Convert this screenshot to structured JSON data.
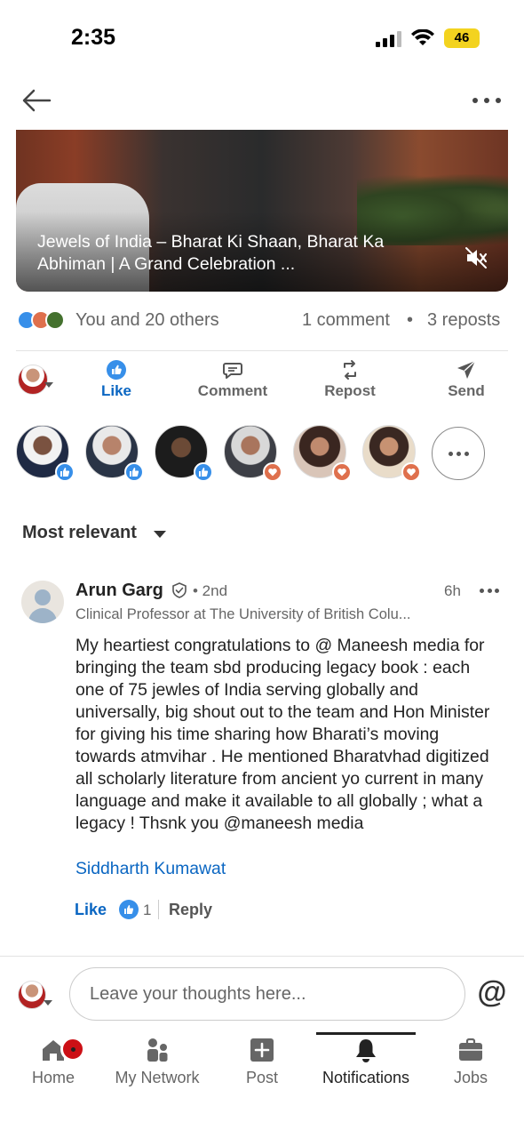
{
  "status_bar": {
    "time": "2:35",
    "battery": "46"
  },
  "header": {
    "back_icon": "arrow-left-icon",
    "more_icon": "ellipsis-icon"
  },
  "video": {
    "caption": "Jewels of India –  Bharat Ki Shaan, Bharat Ka Abhiman | A Grand Celebration ...",
    "mute_icon": "speaker-muted-icon"
  },
  "social_counts": {
    "reactions_text": "You and 20 others",
    "comments_text": "1 comment",
    "separator": "•",
    "reposts_text": "3 reposts"
  },
  "actions": {
    "like": "Like",
    "comment": "Comment",
    "repost": "Repost",
    "send": "Send"
  },
  "reactors": [
    {
      "reaction": "like"
    },
    {
      "reaction": "like"
    },
    {
      "reaction": "like"
    },
    {
      "reaction": "love"
    },
    {
      "reaction": "love"
    },
    {
      "reaction": "love"
    }
  ],
  "sort": {
    "label": "Most relevant"
  },
  "comment": {
    "author": "Arun Garg",
    "degree": "• 2nd",
    "time": "6h",
    "headline": "Clinical Professor at The University of British Colu...",
    "body": "My heartiest congratulations to @ Maneesh media for bringing the team sbd producing legacy book : each one of 75 jewles of India serving globally and universally, big shout out to the team and Hon Minister for giving his time sharing how Bharati’s moving towards atmvihar . He mentioned Bharatvhad digitized all scholarly literature from ancient yo current in many language and make it available to all globally ; what a legacy ! Thsnk you @maneesh media",
    "mention": "Siddharth Kumawat",
    "like_label": "Like",
    "like_count": "1",
    "reply_label": "Reply"
  },
  "compose": {
    "placeholder": "Leave your thoughts here...",
    "at_symbol": "@"
  },
  "bottom_nav": {
    "home": "Home",
    "network": "My Network",
    "post": "Post",
    "notifications": "Notifications",
    "jobs": "Jobs",
    "active": "notifications"
  },
  "colors": {
    "accent": "#0a66c2",
    "like_badge": "#378fe9",
    "love_badge": "#df704d",
    "notification_badge": "#cc1016"
  }
}
